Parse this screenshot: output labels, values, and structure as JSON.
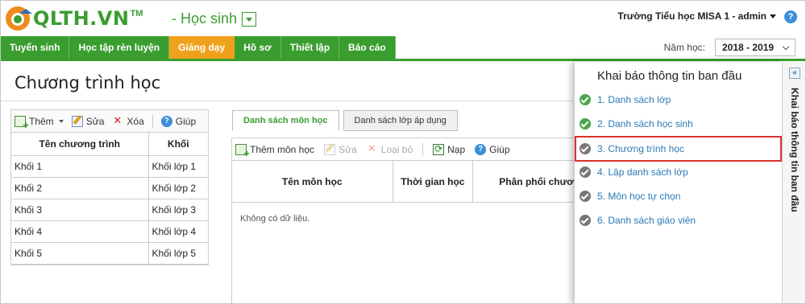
{
  "header": {
    "brand": "QLTH.VN",
    "brand_tm": "TM",
    "module": "- Học sinh",
    "school_user": "Trường Tiểu học MISA 1 - admin",
    "help": "?"
  },
  "nav": {
    "tabs": [
      "Tuyển sinh",
      "Học tập rèn luyện",
      "Giảng dạy",
      "Hồ sơ",
      "Thiết lập",
      "Báo cáo"
    ],
    "active_tab": "Giảng dạy",
    "year_label": "Năm học:",
    "year_value": "2018 - 2019"
  },
  "page": {
    "title": "Chương trình học"
  },
  "left": {
    "toolbar": {
      "add": "Thêm",
      "edit": "Sửa",
      "delete": "Xóa",
      "help": "Giúp"
    },
    "columns": [
      "Tên chương trình",
      "Khối"
    ],
    "rows": [
      [
        "Khối 1",
        "Khối lớp 1"
      ],
      [
        "Khối 2",
        "Khối lớp 2"
      ],
      [
        "Khối 3",
        "Khối lớp 3"
      ],
      [
        "Khối 4",
        "Khối lớp 4"
      ],
      [
        "Khối 5",
        "Khối lớp 5"
      ]
    ]
  },
  "middle": {
    "tabs": [
      "Danh sách môn học",
      "Danh sách lớp áp dụng"
    ],
    "toolbar": {
      "add": "Thêm môn học",
      "edit": "Sửa",
      "remove": "Loại bỏ",
      "reload": "Nạp",
      "help": "Giúp"
    },
    "columns": [
      "Tên môn học",
      "Thời gian học",
      "Phân phối chươ"
    ],
    "empty": "Không có dữ liệu."
  },
  "flyout": {
    "title": "Khai báo thông tin ban đầu",
    "side_label": "Khai báo thông tin ban đầu",
    "collapse": "«",
    "steps": [
      {
        "label": "1. Danh sách lớp",
        "status": "done"
      },
      {
        "label": "2. Danh sách học sinh",
        "status": "done"
      },
      {
        "label": "3. Chương trình học",
        "status": "todo"
      },
      {
        "label": "4. Lập danh sách lớp",
        "status": "todo"
      },
      {
        "label": "5. Môn học tự chọn",
        "status": "todo"
      },
      {
        "label": "6. Danh sách giáo viên",
        "status": "todo"
      }
    ],
    "selected_step": 2
  },
  "colors": {
    "brand_green": "#3a9d2f",
    "active_orange": "#f0a11c",
    "link_blue": "#2a7ab5",
    "highlight_red": "#d9312c"
  }
}
